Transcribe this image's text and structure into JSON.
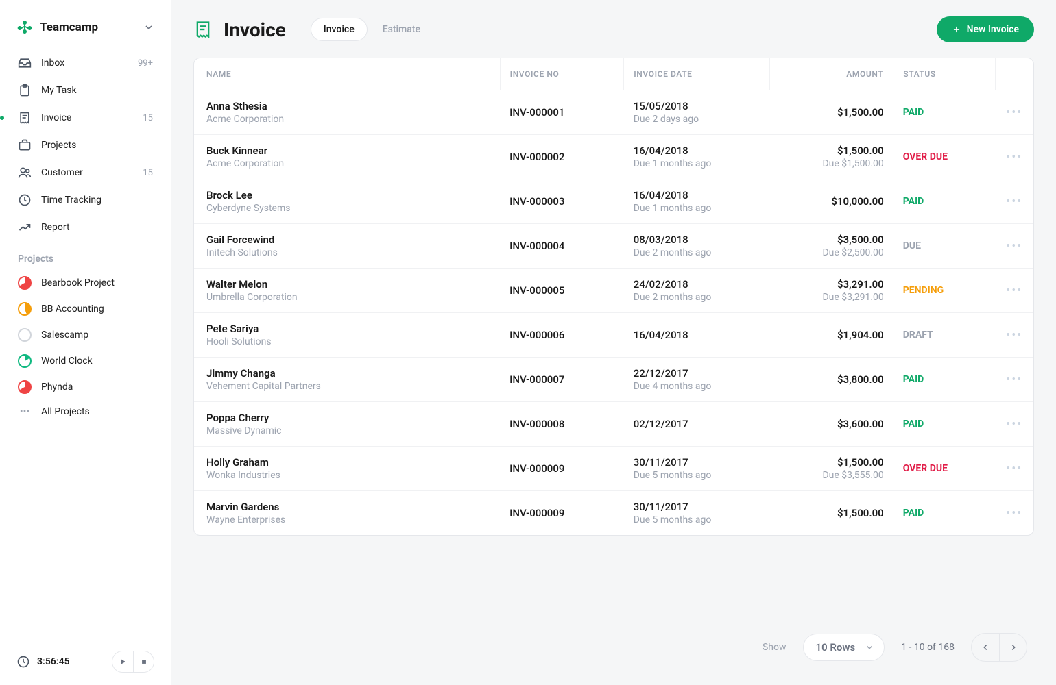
{
  "brand": {
    "name": "Teamcamp"
  },
  "nav": [
    {
      "key": "inbox",
      "label": "Inbox",
      "badge": "99+"
    },
    {
      "key": "mytask",
      "label": "My Task",
      "badge": ""
    },
    {
      "key": "invoice",
      "label": "Invoice",
      "badge": "15",
      "active": true
    },
    {
      "key": "projects",
      "label": "Projects",
      "badge": ""
    },
    {
      "key": "customer",
      "label": "Customer",
      "badge": "15"
    },
    {
      "key": "time",
      "label": "Time Tracking",
      "badge": ""
    },
    {
      "key": "report",
      "label": "Report",
      "badge": ""
    }
  ],
  "projects_section_title": "Projects",
  "projects": [
    {
      "label": "Bearbook Project",
      "color": "red"
    },
    {
      "label": "BB Accounting",
      "color": "orange"
    },
    {
      "label": "Salescamp",
      "color": "grey"
    },
    {
      "label": "World Clock",
      "color": "green"
    },
    {
      "label": "Phynda",
      "color": "red"
    }
  ],
  "all_projects_label": "All Projects",
  "timer": "3:56:45",
  "page": {
    "title": "Invoice",
    "tabs": [
      {
        "label": "Invoice",
        "active": true
      },
      {
        "label": "Estimate",
        "active": false
      }
    ],
    "new_button": "New Invoice"
  },
  "table": {
    "headers": {
      "name": "NAME",
      "no": "INVOICE NO",
      "date": "INVOICE DATE",
      "amount": "AMOUNT",
      "status": "STATUS"
    },
    "rows": [
      {
        "name": "Anna Sthesia",
        "company": "Acme Corporation",
        "no": "INV-000001",
        "date": "15/05/2018",
        "due": "Due 2 days ago",
        "amount": "$1,500.00",
        "amount_due": "",
        "status": "PAID"
      },
      {
        "name": "Buck Kinnear",
        "company": "Acme Corporation",
        "no": "INV-000002",
        "date": "16/04/2018",
        "due": "Due 1 months ago",
        "amount": "$1,500.00",
        "amount_due": "Due $1,500.00",
        "status": "OVER DUE"
      },
      {
        "name": "Brock Lee",
        "company": "Cyberdyne Systems",
        "no": "INV-000003",
        "date": "16/04/2018",
        "due": "Due 1 months ago",
        "amount": "$10,000.00",
        "amount_due": "",
        "status": "PAID"
      },
      {
        "name": "Gail Forcewind",
        "company": "Initech Solutions",
        "no": "INV-000004",
        "date": "08/03/2018",
        "due": "Due 2 months ago",
        "amount": "$3,500.00",
        "amount_due": "Due $2,500.00",
        "status": "DUE"
      },
      {
        "name": "Walter Melon",
        "company": "Umbrella Corporation",
        "no": "INV-000005",
        "date": "24/02/2018",
        "due": "Due 2 months ago",
        "amount": "$3,291.00",
        "amount_due": "Due $3,291.00",
        "status": "PENDING"
      },
      {
        "name": "Pete Sariya",
        "company": "Hooli Solutions",
        "no": "INV-000006",
        "date": "16/04/2018",
        "due": "",
        "amount": "$1,904.00",
        "amount_due": "",
        "status": "DRAFT"
      },
      {
        "name": "Jimmy Changa",
        "company": "Vehement Capital Partners",
        "no": "INV-000007",
        "date": "22/12/2017",
        "due": "Due 4 months ago",
        "amount": "$3,800.00",
        "amount_due": "",
        "status": "PAID"
      },
      {
        "name": "Poppa Cherry",
        "company": "Massive Dynamic",
        "no": "INV-000008",
        "date": "02/12/2017",
        "due": "",
        "amount": "$3,600.00",
        "amount_due": "",
        "status": "PAID"
      },
      {
        "name": "Holly Graham",
        "company": "Wonka Industries",
        "no": "INV-000009",
        "date": "30/11/2017",
        "due": "Due 5 months ago",
        "amount": "$1,500.00",
        "amount_due": "Due $3,555.00",
        "status": "OVER DUE"
      },
      {
        "name": "Marvin Gardens",
        "company": "Wayne Enterprises",
        "no": "INV-000009",
        "date": "30/11/2017",
        "due": "Due 5 months ago",
        "amount": "$1,500.00",
        "amount_due": "",
        "status": "PAID"
      }
    ]
  },
  "pagination": {
    "show_label": "Show",
    "rows_label": "10 Rows",
    "range": "1 - 10 of 168"
  }
}
